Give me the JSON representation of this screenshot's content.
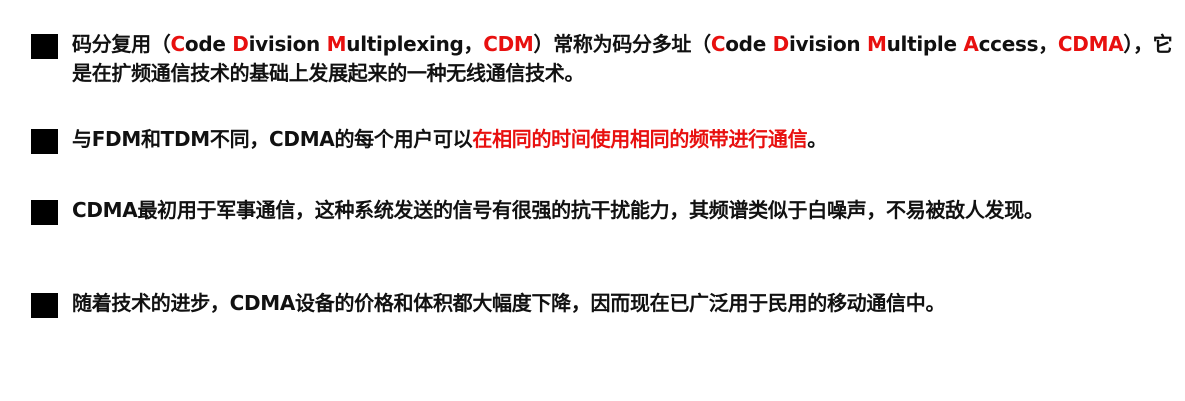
{
  "colors": {
    "text": "#111111",
    "accent": "#e8100f",
    "bullet": "#000000"
  },
  "bullet_icon": "black-square-icon",
  "items": [
    {
      "segments": [
        {
          "text": "码分复用（",
          "red": false
        },
        {
          "text": "C",
          "red": true
        },
        {
          "text": "ode ",
          "red": false
        },
        {
          "text": "D",
          "red": true
        },
        {
          "text": "ivision ",
          "red": false
        },
        {
          "text": "M",
          "red": true
        },
        {
          "text": "ultiplexing，",
          "red": false
        },
        {
          "text": "CDM",
          "red": true
        },
        {
          "text": "）常称为码分多址（",
          "red": false
        },
        {
          "text": "C",
          "red": true
        },
        {
          "text": "ode ",
          "red": false
        },
        {
          "text": "D",
          "red": true
        },
        {
          "text": "ivision ",
          "red": false
        },
        {
          "text": "M",
          "red": true
        },
        {
          "text": "ultiple ",
          "red": false
        },
        {
          "text": "A",
          "red": true
        },
        {
          "text": "ccess，",
          "red": false
        },
        {
          "text": "CDMA",
          "red": true
        },
        {
          "text": "），它是在扩频通信技术的基础上发展起来的一种无线通信技术。",
          "red": false
        }
      ]
    },
    {
      "segments": [
        {
          "text": "与FDM和TDM不同，CDMA的每个用户可以",
          "red": false
        },
        {
          "text": "在相同的时间使用相同的频带进行通信",
          "red": true
        },
        {
          "text": "。",
          "red": false
        }
      ]
    },
    {
      "segments": [
        {
          "text": "CDMA最初用于军事通信，这种系统发送的信号有很强的抗干扰能力，其频谱类似于白噪声，不易被敌人发现。",
          "red": false
        }
      ]
    },
    {
      "segments": [
        {
          "text": "随着技术的进步，CDMA设备的价格和体积都大幅度下降，因而现在已广泛用于民用的移动通信中。",
          "red": false
        }
      ]
    }
  ]
}
